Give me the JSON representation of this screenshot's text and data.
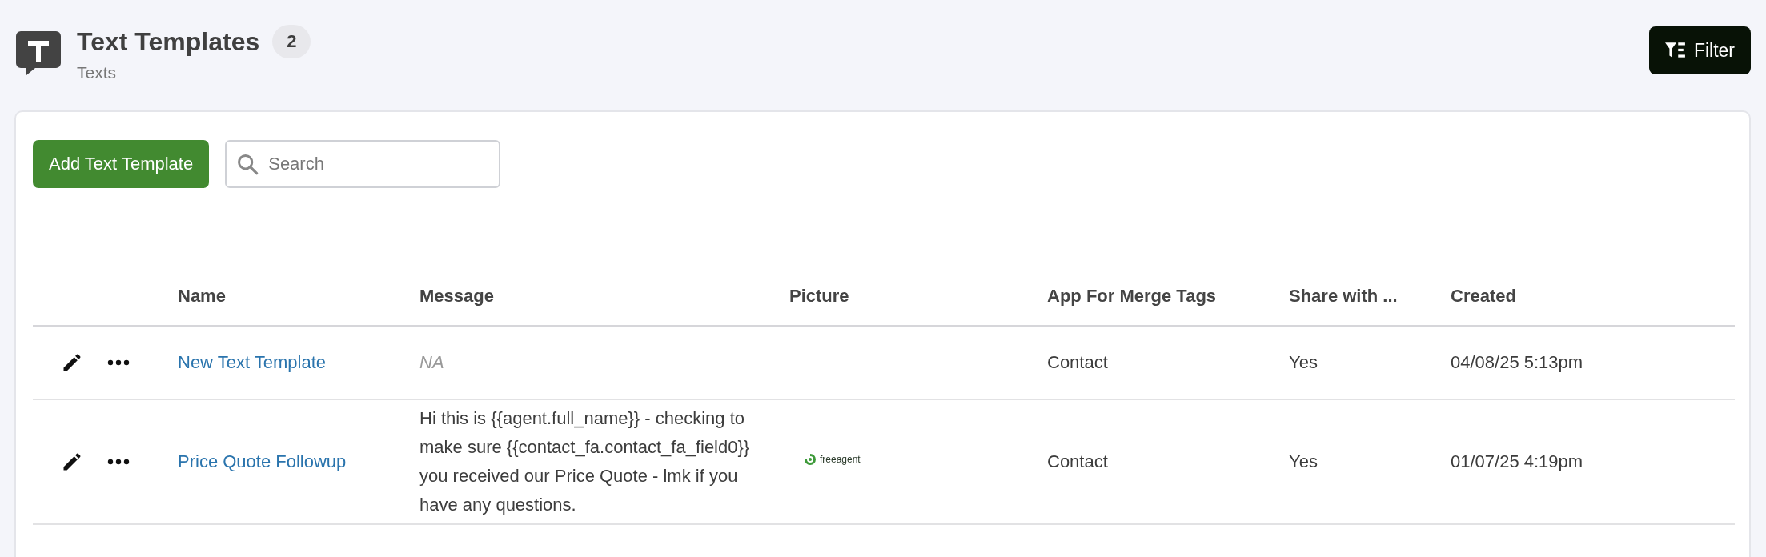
{
  "header": {
    "title": "Text Templates",
    "count": "2",
    "subtitle": "Texts"
  },
  "filter_button": {
    "label": "Filter"
  },
  "toolbar": {
    "add_button": "Add Text Template",
    "search": {
      "placeholder": "Search"
    }
  },
  "table": {
    "columns": [
      "Name",
      "Message",
      "Picture",
      "App For Merge Tags",
      "Share with ...",
      "Created"
    ],
    "rows": [
      {
        "name": "New Text Template",
        "message": "NA",
        "message_missing": true,
        "picture": null,
        "app": "Contact",
        "share": "Yes",
        "created": "04/08/25 5:13pm"
      },
      {
        "name": "Price Quote Followup",
        "message": "Hi this is {{agent.full_name}} - checking to make sure {{contact_fa.contact_fa_field0}} you received our Price Quote - lmk if you have any questions.",
        "message_missing": false,
        "picture": {
          "kind": "logo",
          "text": "freeagent"
        },
        "app": "Contact",
        "share": "Yes",
        "created": "01/07/25 4:19pm"
      }
    ]
  }
}
